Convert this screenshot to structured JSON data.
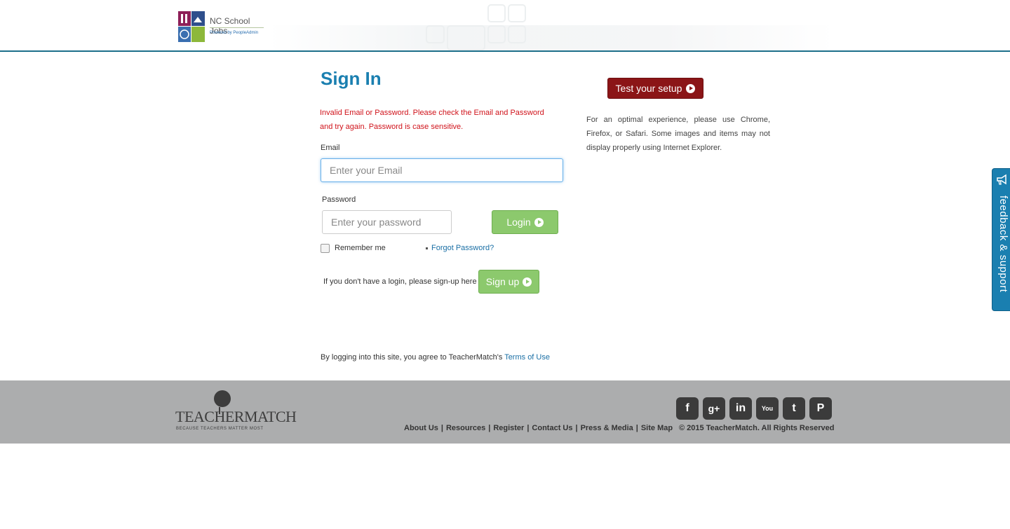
{
  "header": {
    "brand_title": "NC School Jobs",
    "brand_sub": "Powered by PeopleAdmin"
  },
  "signin": {
    "title": "Sign In",
    "error": "Invalid Email or Password. Please check the Email and Password and try again. Password is case sensitive.",
    "email_label": "Email",
    "email_placeholder": "Enter your Email",
    "password_label": "Password",
    "password_placeholder": "Enter your password",
    "login_label": "Login",
    "remember_label": "Remember me",
    "forgot_label": "Forgot Password?",
    "signup_prompt": "If you don't have a login, please sign-up here",
    "signup_label": "Sign up",
    "terms_prefix": "By logging into this site, you agree to TeacherMatch's",
    "terms_link": "Terms of Use"
  },
  "side": {
    "test_setup_label": "Test your setup",
    "browser_note": "For an optimal experience, please use Chrome, Firefox, or Safari. Some images and items may not display properly using Internet Explorer."
  },
  "feedback": {
    "label": "feedback & support"
  },
  "footer": {
    "logo_word": "TEACHERMATCH",
    "logo_tagline": "BECAUSE TEACHERS MATTER MOST",
    "social": [
      {
        "name": "facebook-icon",
        "glyph": "f"
      },
      {
        "name": "google-plus-icon",
        "glyph": "g+"
      },
      {
        "name": "linkedin-icon",
        "glyph": "in"
      },
      {
        "name": "youtube-icon",
        "glyph": "You"
      },
      {
        "name": "twitter-icon",
        "glyph": "t"
      },
      {
        "name": "pinterest-icon",
        "glyph": "P"
      }
    ],
    "links": [
      "About Us",
      "Resources",
      "Register",
      "Contact Us",
      "Press & Media",
      "Site Map"
    ],
    "copyright": "© 2015 TeacherMatch. All Rights Reserved"
  },
  "colors": {
    "accent_blue": "#1a7fb0",
    "error_red": "#d0131b",
    "button_green": "#8cc96d",
    "button_red": "#8b1517",
    "footer_grey": "#acadae"
  }
}
